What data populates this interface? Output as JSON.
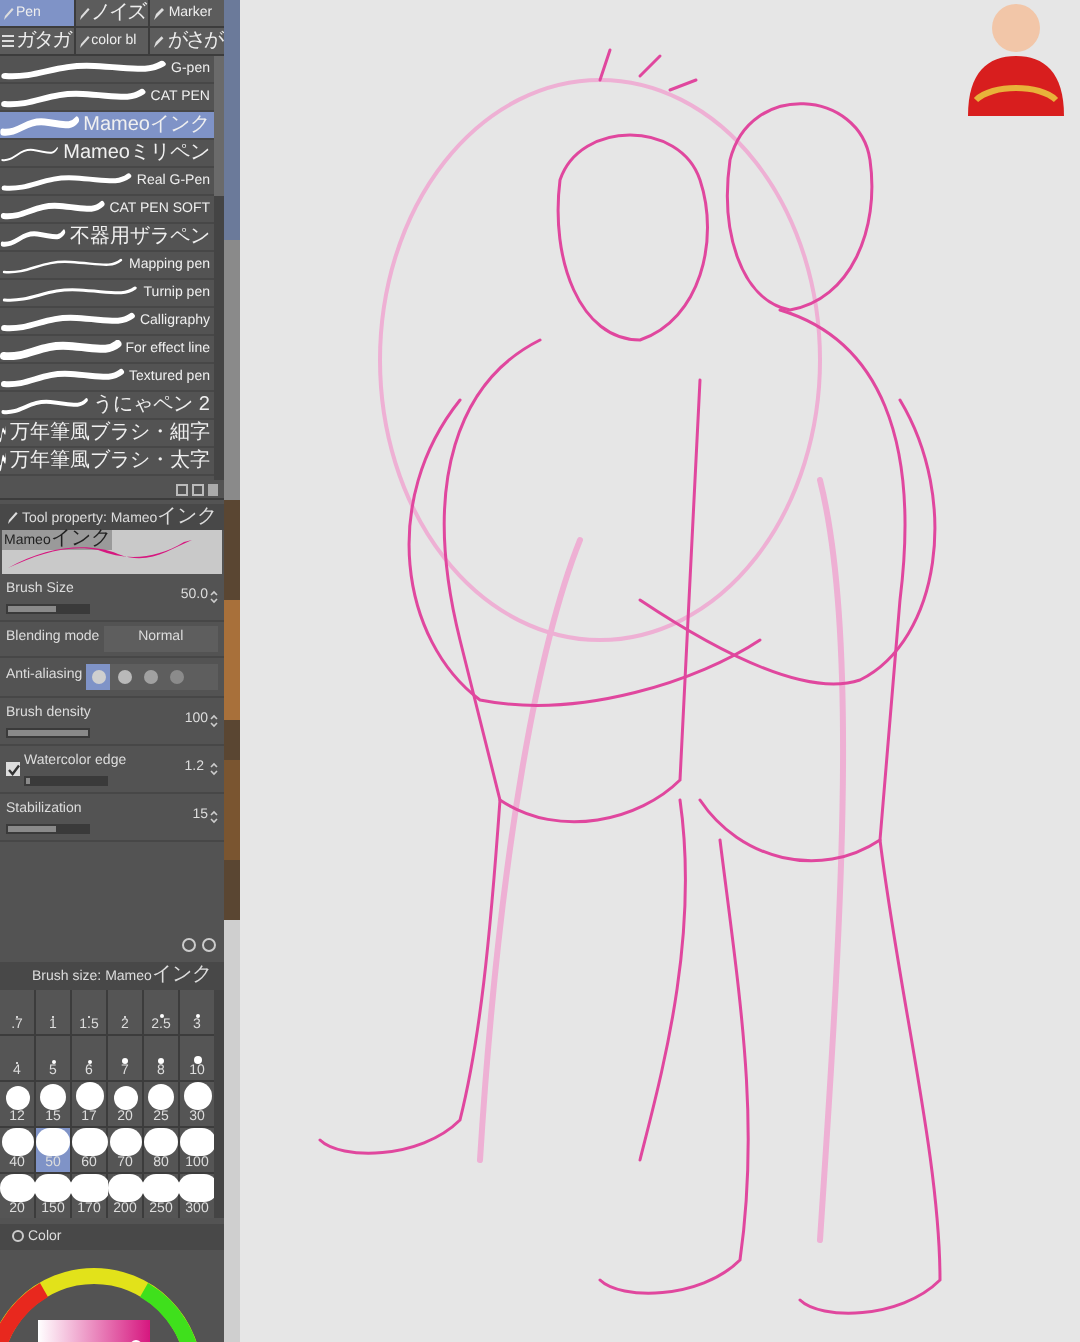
{
  "tool_tabs": [
    {
      "label": "Pen",
      "selected": true
    },
    {
      "label": "ノイズ",
      "selected": false
    },
    {
      "label": "Marker",
      "selected": false
    },
    {
      "label": "ガタガ",
      "selected": false
    },
    {
      "label": "color bl",
      "selected": false
    },
    {
      "label": "がさが",
      "selected": false
    }
  ],
  "brushes": [
    {
      "name": "G-pen",
      "selected": false
    },
    {
      "name": "CAT PEN",
      "selected": false
    },
    {
      "name": "Mameoインク",
      "selected": true
    },
    {
      "name": "Mameoミリペン",
      "selected": false
    },
    {
      "name": "Real G-Pen",
      "selected": false
    },
    {
      "name": "CAT PEN SOFT",
      "selected": false
    },
    {
      "name": "不器用ザラペン",
      "selected": false
    },
    {
      "name": "Mapping pen",
      "selected": false
    },
    {
      "name": "Turnip pen",
      "selected": false
    },
    {
      "name": "Calligraphy",
      "selected": false
    },
    {
      "name": "For effect line",
      "selected": false
    },
    {
      "name": "Textured pen",
      "selected": false
    },
    {
      "name": "うにゃペン 2",
      "selected": false
    },
    {
      "name": "万年筆風ブラシ・細字",
      "selected": false
    },
    {
      "name": "万年筆風ブラシ・太字",
      "selected": false
    }
  ],
  "tool_property": {
    "title_prefix": "Tool property: Mameo",
    "title_suffix": "インク",
    "preview_prefix": "Mameo",
    "preview_suffix": "インク",
    "settings": [
      {
        "kind": "slider",
        "label": "Brush Size",
        "value": "50.0",
        "level": 0.6
      },
      {
        "kind": "select",
        "label": "Blending mode",
        "value": "Normal"
      },
      {
        "kind": "antialias",
        "label": "Anti-aliasing",
        "options": [
          {
            "selected": true
          },
          {
            "selected": false
          },
          {
            "selected": false
          },
          {
            "selected": false
          }
        ]
      },
      {
        "kind": "slider",
        "label": "Brush density",
        "value": "100",
        "level": 1
      },
      {
        "kind": "check",
        "label": "Watercolor edge",
        "checked": true,
        "value": "1.2",
        "level": 0.05
      },
      {
        "kind": "slider",
        "label": "Stabilization",
        "value": "15",
        "level": 0.6
      }
    ]
  },
  "brush_size": {
    "title_prefix": "Brush size: Mameo",
    "title_suffix": "インク",
    "sizes": [
      {
        "label": ".7",
        "selected": false
      },
      {
        "label": "1",
        "selected": false
      },
      {
        "label": "1.5",
        "selected": false
      },
      {
        "label": "2",
        "selected": false
      },
      {
        "label": "2.5",
        "selected": false
      },
      {
        "label": "3",
        "selected": false
      },
      {
        "label": "4",
        "selected": false
      },
      {
        "label": "5",
        "selected": false
      },
      {
        "label": "6",
        "selected": false
      },
      {
        "label": "7",
        "selected": false
      },
      {
        "label": "8",
        "selected": false
      },
      {
        "label": "10",
        "selected": false
      },
      {
        "label": "12",
        "selected": false
      },
      {
        "label": "15",
        "selected": false
      },
      {
        "label": "17",
        "selected": false
      },
      {
        "label": "20",
        "selected": false
      },
      {
        "label": "25",
        "selected": false
      },
      {
        "label": "30",
        "selected": false
      },
      {
        "label": "40",
        "selected": false
      },
      {
        "label": "50",
        "selected": true
      },
      {
        "label": "60",
        "selected": false
      },
      {
        "label": "70",
        "selected": false
      },
      {
        "label": "80",
        "selected": false
      },
      {
        "label": "100",
        "selected": false
      },
      {
        "label": "20",
        "selected": false
      },
      {
        "label": "150",
        "selected": false
      },
      {
        "label": "170",
        "selected": false
      },
      {
        "label": "200",
        "selected": false
      },
      {
        "label": "250",
        "selected": false
      },
      {
        "label": "300",
        "selected": false
      }
    ]
  },
  "color_panel": {
    "tab": "Color"
  }
}
